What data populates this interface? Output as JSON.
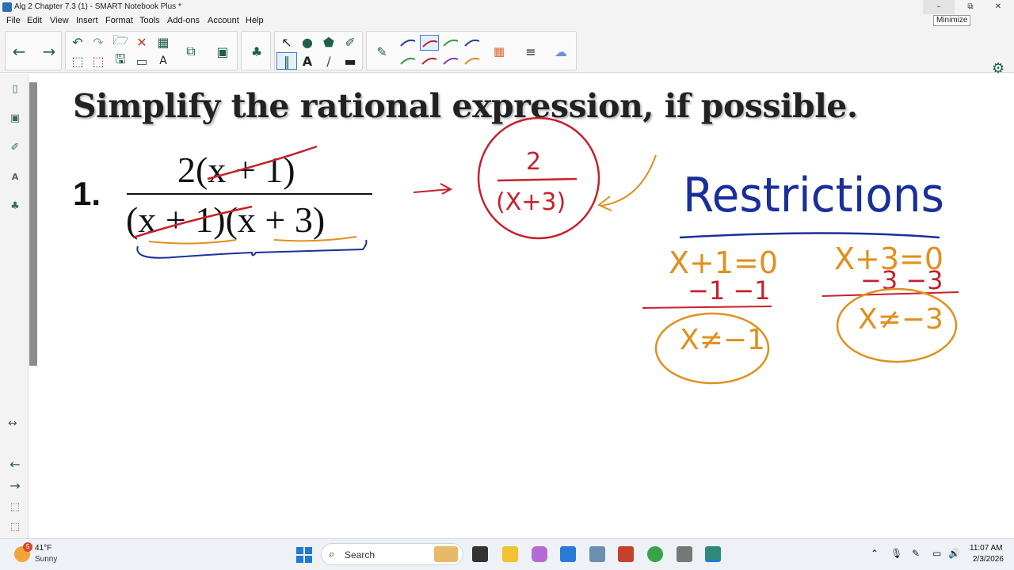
{
  "window": {
    "title": "Alg 2 Chapter 7.3 (1) - SMART Notebook Plus *",
    "tooltip": "Minimize",
    "controls": {
      "minimize": "–",
      "maximize": "⧉",
      "close": "✕"
    }
  },
  "menu": [
    "File",
    "Edit",
    "View",
    "Insert",
    "Format",
    "Tools",
    "Add-ons",
    "Account",
    "Help"
  ],
  "toolbar": {
    "icons": [
      "back-arrow-icon",
      "forward-arrow-icon",
      "undo-icon",
      "redo-icon",
      "open-file-icon",
      "delete-icon",
      "table-icon",
      "add-page-icon",
      "delete-page-icon",
      "save-icon",
      "screen-shade-icon",
      "text-recognition-icon",
      "paste-icon",
      "camera-icon",
      "addon-icon",
      "select-icon",
      "pens-icon",
      "shapes-icon",
      "text-icon",
      "lines-icon",
      "fill-icon",
      "eraser-icon",
      "pen-styles-icon",
      "color-palette-icon",
      "line-properties-icon",
      "magic-pen-icon",
      "gear-icon",
      "collapse-toolbar-icon"
    ],
    "pen_colors": [
      "#1f3f8f",
      "#c0202a",
      "#3a9a3a",
      "#1f3f8f",
      "#3a9a3a",
      "#c0202a",
      "#7a3fb0",
      "#e08a1e"
    ]
  },
  "sidebar": {
    "icons": [
      "page-sorter-icon",
      "gallery-icon",
      "attachments-icon",
      "properties-icon",
      "addons-icon",
      "resize-handle-icon",
      "previous-page-icon",
      "next-page-icon",
      "add-page-icon",
      "delete-page-icon"
    ]
  },
  "page": {
    "heading": "Simplify the rational expression, if possible.",
    "problem_number": "1.",
    "numerator": "2(x + 1)",
    "denominator": "(x + 1)(x + 3)"
  },
  "ink": {
    "result_numerator": "2",
    "result_denominator": "(X+3)",
    "restrictions_label": "Restrictions",
    "eq1": "X+1=0",
    "eq1_step": "−1 −1",
    "eq1_result": "X≠−1",
    "eq2": "X+3=0",
    "eq2_step": "−3 −3",
    "eq2_result": "X≠−3",
    "colors": {
      "red": "#c8202c",
      "blue": "#1a2f9a",
      "orange": "#e0901c"
    }
  },
  "taskbar": {
    "weather_badge": "5",
    "temperature": "41°F",
    "condition": "Sunny",
    "search_label": "Search",
    "time": "11:07 AM",
    "date": "2/3/2026",
    "pinned_apps": [
      "widgets-icon",
      "file-explorer-icon",
      "copilot-icon",
      "store-icon",
      "remote-desktop-icon",
      "office-icon",
      "chrome-icon",
      "settings-app-icon",
      "smart-notebook-icon"
    ],
    "tray_icons": [
      "chevron-up-icon",
      "microphone-icon",
      "pen-tray-icon",
      "network-icon",
      "volume-icon"
    ]
  }
}
